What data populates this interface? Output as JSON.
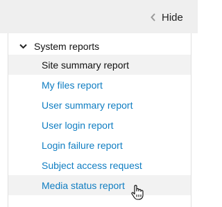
{
  "hide_button": {
    "label": "Hide",
    "icon": "chevron-left-icon"
  },
  "section": {
    "title": "System reports",
    "icon": "chevron-down-icon",
    "items": [
      {
        "label": "Site summary report",
        "state": "active"
      },
      {
        "label": "My files report",
        "state": "link"
      },
      {
        "label": "User summary report",
        "state": "link"
      },
      {
        "label": "User login report",
        "state": "link"
      },
      {
        "label": "Login failure report",
        "state": "link"
      },
      {
        "label": "Subject access request",
        "state": "link"
      },
      {
        "label": "Media status report",
        "state": "hover"
      }
    ]
  },
  "colors": {
    "link": "#0f7dc2",
    "text": "#111111",
    "active_bg": "#f2f2f2",
    "topbar_bg": "#efefef"
  }
}
